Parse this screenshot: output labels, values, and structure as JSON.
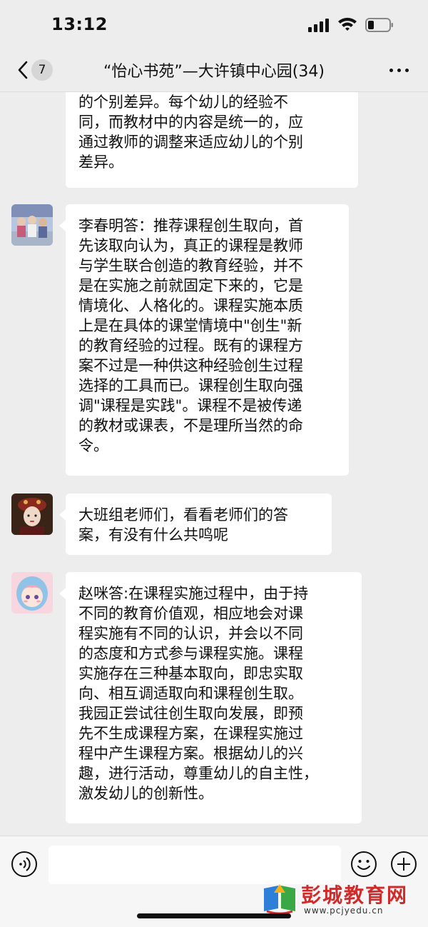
{
  "status_bar": {
    "time": "13:12"
  },
  "header": {
    "unread_count": "7",
    "title": "“怡心书苑”—大许镇中心园(34)"
  },
  "messages": [
    {
      "lines": [
        "的个别差异。每个幼儿的经验不",
        "同，而教材中的内容是统一的，应",
        "通过教师的调整来适应幼儿的个别",
        "差异。"
      ]
    },
    {
      "lines": [
        "李春明答：推荐课程创生取向，首",
        "先该取向认为，真正的课程是教师",
        "与学生联合创造的教育经验，并不",
        "是在实施之前就固定下来的，它是",
        "情境化、人格化的。课程实施本质",
        "上是在具体的课堂情境中\"创生\"新",
        "的教育经验的过程。既有的课程方",
        "案不过是一种供这种经验创生过程",
        "选择的工具而已。课程创生取向强",
        "调\"课程是实践\"。课程不是被传递",
        "的教材或课表，不是理所当然的命",
        "令。"
      ]
    },
    {
      "lines": [
        "大班组老师们，看看老师们的答",
        "案，有没有什么共鸣呢"
      ]
    },
    {
      "lines": [
        "赵咪答:在课程实施过程中，由于持",
        "不同的教育价值观，相应地会对课",
        "程实施有不同的认识，并会以不同",
        "的态度和方式参与课程实施。课程",
        "实施存在三种基本取向，即忠实取",
        "向、相互调适取向和课程创生取。",
        "我园正尝试往创生取向发展，即预",
        "先不生成课程方案，在课程实施过",
        "程中产生课程方案。根据幼儿的兴",
        "趣，进行活动，尊重幼儿的自主性，",
        "激发幼儿的创新性。"
      ]
    }
  ],
  "input": {
    "placeholder": ""
  },
  "watermark": {
    "name": "彭城教育网",
    "url": "www.pcjyedu.cn"
  }
}
